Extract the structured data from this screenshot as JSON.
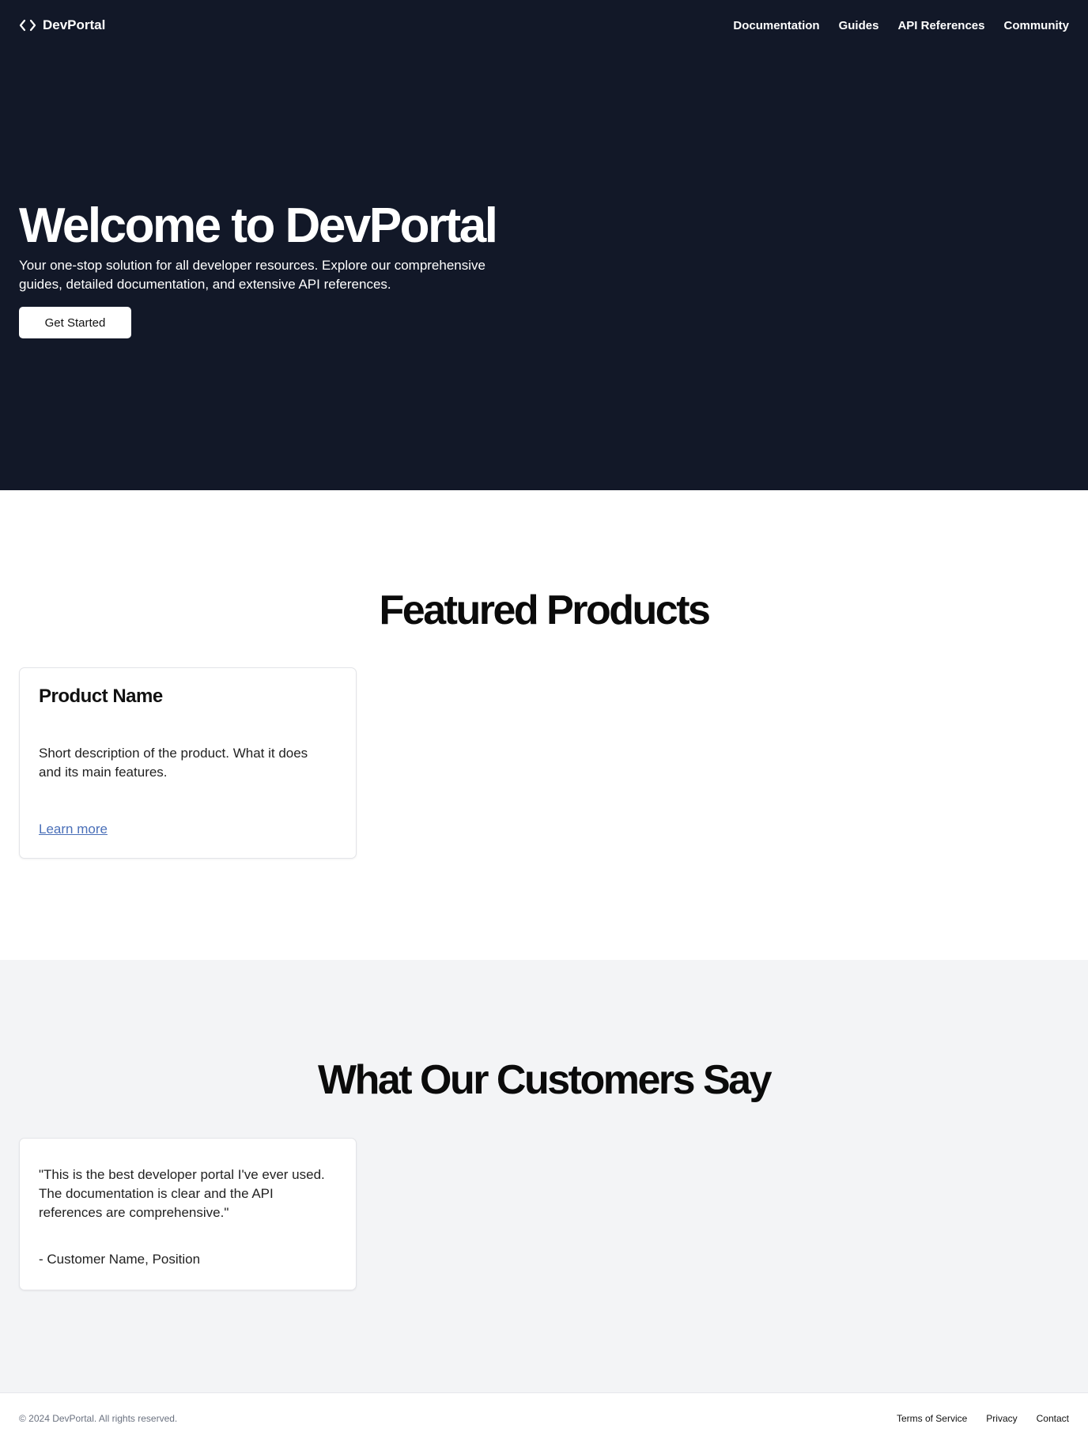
{
  "header": {
    "brand": "DevPortal",
    "nav": [
      "Documentation",
      "Guides",
      "API References",
      "Community"
    ]
  },
  "hero": {
    "title": "Welcome to DevPortal",
    "subtitle_line1": "Your one-stop solution for all developer resources. Explore our comprehensive",
    "subtitle_line2": "guides, detailed documentation, and extensive API references.",
    "cta": "Get Started"
  },
  "products": {
    "title": "Featured Products",
    "items": [
      {
        "name": "Product Name",
        "description": "Short description of the product. What it does and its main features.",
        "link": "Learn more"
      }
    ]
  },
  "testimonials": {
    "title": "What Our Customers Say",
    "items": [
      {
        "quote": "\"This is the best developer portal I've ever used. The documentation is clear and the API references are comprehensive.\"",
        "author": "- Customer Name, Position"
      }
    ]
  },
  "footer": {
    "copyright": "© 2024 DevPortal. All rights reserved.",
    "links": [
      "Terms of Service",
      "Privacy",
      "Contact"
    ]
  },
  "colors": {
    "hero_bg": "#121828",
    "section_alt_bg": "#f3f4f6",
    "link": "#4a6fb8"
  },
  "icons": {
    "brand": "code-icon"
  }
}
